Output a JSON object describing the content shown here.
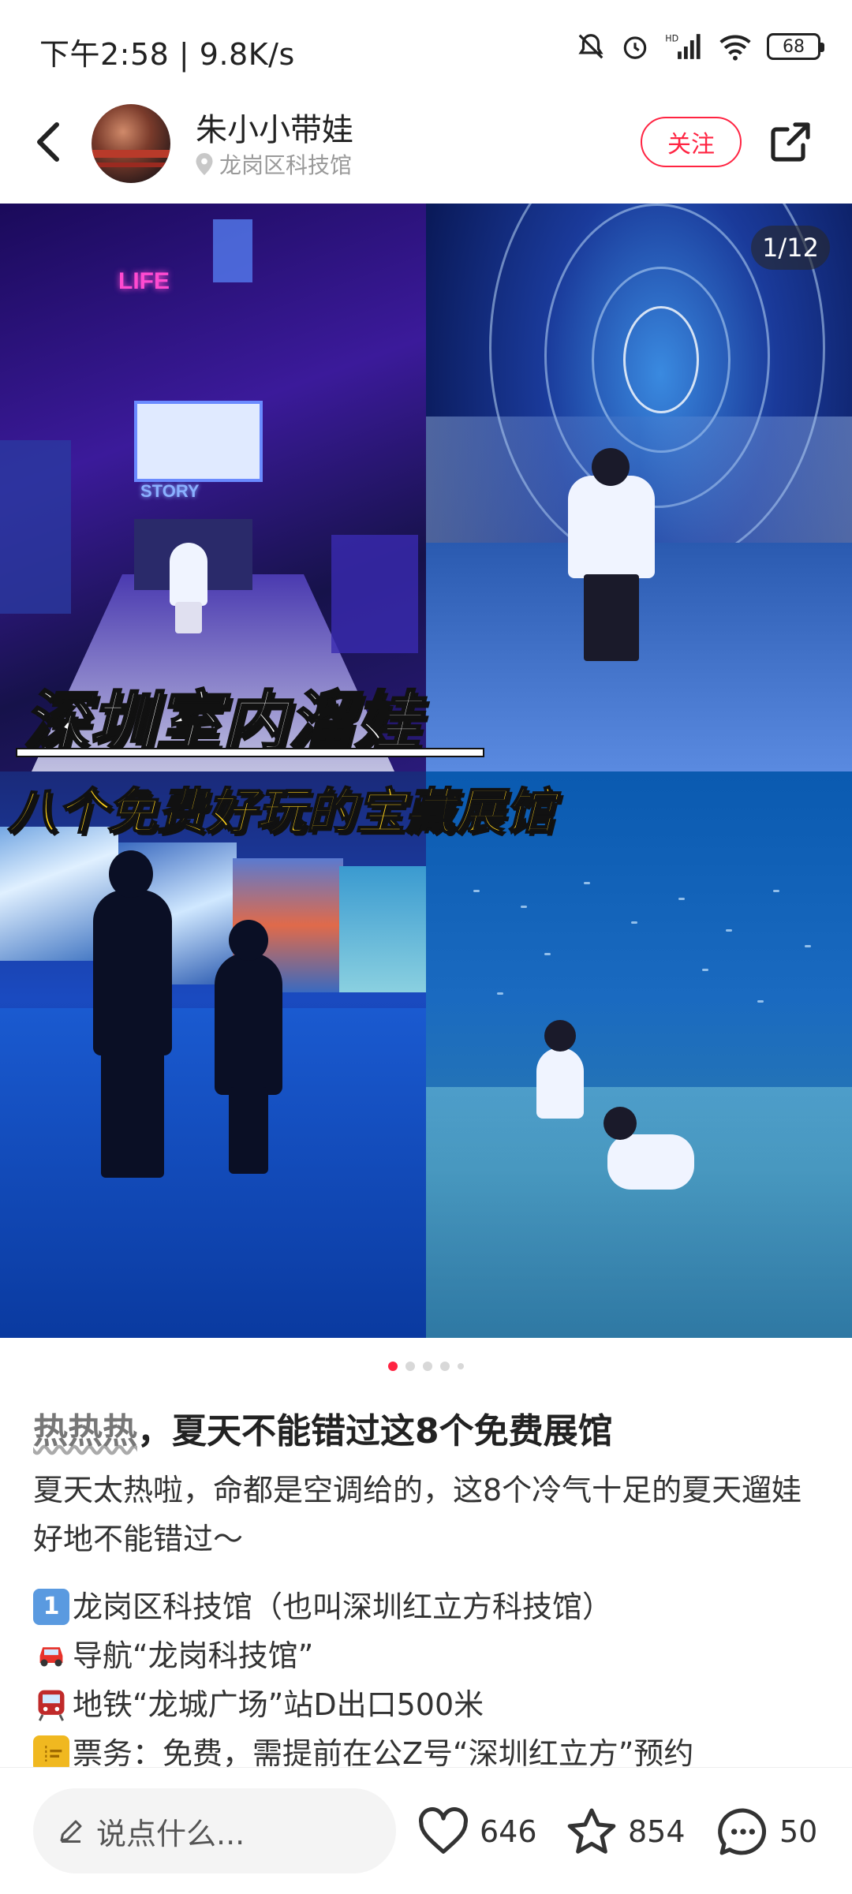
{
  "status": {
    "time": "下午2:58 | 9.8K/s",
    "battery": "68"
  },
  "header": {
    "user_name": "朱小小带娃",
    "location": "龙岗区科技馆",
    "follow_label": "关注"
  },
  "carousel": {
    "page_counter": "1/12",
    "overlay_title": "深圳室内溜娃",
    "overlay_subtitle": "八个免费好玩的宝藏展馆",
    "neon_life": "LIFE",
    "neon_story": "STORY",
    "dot_count": 5,
    "active_dot": 0
  },
  "post": {
    "title_prefix": "热热热",
    "title_rest": "，夏天不能错过这8个免费展馆",
    "description": "夏天太热啦，命都是空调给的，这8个冷气十足的夏天遛娃好地不能错过～",
    "lines": [
      {
        "emoji": "1",
        "text": "龙岗区科技馆（也叫深圳红立方科技馆）"
      },
      {
        "emoji": "car",
        "text": "导航“龙岗科技馆”"
      },
      {
        "emoji": "metro",
        "text": "地铁“龙城广场”站D出口500米"
      },
      {
        "emoji": "ticket",
        "text": "票务：免费，需提前在公Z号“深圳红立方”预约"
      }
    ]
  },
  "bottom": {
    "comment_placeholder": "说点什么...",
    "likes": "646",
    "favorites": "854",
    "comments": "50"
  }
}
